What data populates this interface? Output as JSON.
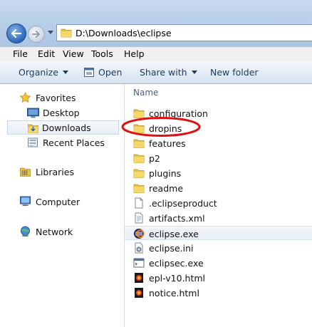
{
  "address": {
    "path": "D:\\Downloads\\eclipse"
  },
  "menu": {
    "items": [
      "File",
      "Edit",
      "View",
      "Tools",
      "Help"
    ]
  },
  "toolbar": {
    "organize": "Organize",
    "open": "Open",
    "share_with": "Share with",
    "new_folder": "New folder"
  },
  "sidebar": {
    "favorites": "Favorites",
    "desktop": "Desktop",
    "downloads": "Downloads",
    "recent_places": "Recent Places",
    "libraries": "Libraries",
    "computer": "Computer",
    "network": "Network"
  },
  "content": {
    "column_name": "Name",
    "files": [
      {
        "name": "configuration",
        "icon": "folder-icon"
      },
      {
        "name": "dropins",
        "icon": "folder-icon"
      },
      {
        "name": "features",
        "icon": "folder-icon"
      },
      {
        "name": "p2",
        "icon": "folder-icon"
      },
      {
        "name": "plugins",
        "icon": "folder-icon"
      },
      {
        "name": "readme",
        "icon": "folder-icon"
      },
      {
        "name": ".eclipseproduct",
        "icon": "blank-file-icon"
      },
      {
        "name": "artifacts.xml",
        "icon": "xml-file-icon"
      },
      {
        "name": "eclipse.exe",
        "icon": "eclipse-icon"
      },
      {
        "name": "eclipse.ini",
        "icon": "ini-file-icon"
      },
      {
        "name": "eclipsec.exe",
        "icon": "console-exe-icon"
      },
      {
        "name": "epl-v10.html",
        "icon": "html-file-icon"
      },
      {
        "name": "notice.html",
        "icon": "html-file-icon"
      }
    ]
  },
  "colors": {
    "annotation": "#e01010",
    "toolbar_text": "#1e3a5f",
    "selection": "#e6edf4"
  }
}
